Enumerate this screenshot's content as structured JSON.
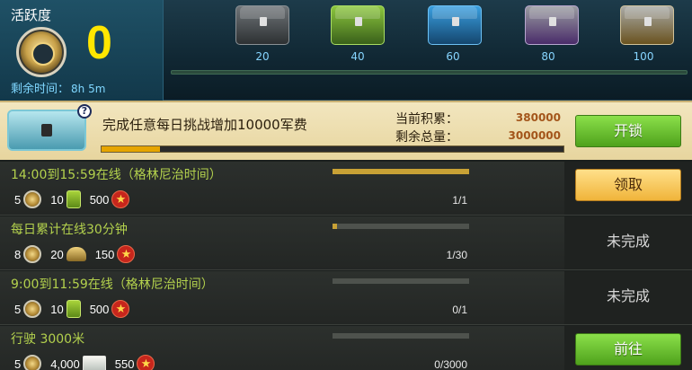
{
  "activity": {
    "title": "活跃度",
    "value": "0",
    "remaining_label": "剩余时间：",
    "remaining_value": "8h 5m",
    "milestones": [
      {
        "label": "20",
        "icon": "gray-crate-icon"
      },
      {
        "label": "40",
        "icon": "green-crate-icon"
      },
      {
        "label": "60",
        "icon": "blue-crate-icon"
      },
      {
        "label": "80",
        "icon": "purple-crate-icon"
      },
      {
        "label": "100",
        "icon": "gold-crate-icon"
      }
    ],
    "progress": 0
  },
  "banner": {
    "help": "?",
    "description": "完成任意每日挑战增加10000军费",
    "current_label": "当前积累：",
    "current_value": "380000",
    "total_label": "剩余总量：",
    "total_value": "3000000",
    "progress_fraction": 0.127,
    "unlock_label": "开锁"
  },
  "tasks": [
    {
      "title": "14:00到15:59在线（格林尼治时间）",
      "rewards": [
        {
          "amount": "5",
          "icon": "medal-icon"
        },
        {
          "amount": "10",
          "icon": "fuel-can-icon"
        },
        {
          "amount": "500",
          "icon": "star-icon"
        }
      ],
      "progress_fraction": 1.0,
      "count": "1/1",
      "action": "领取",
      "action_type": "claim"
    },
    {
      "title": "每日累计在线30分钟",
      "rewards": [
        {
          "amount": "8",
          "icon": "medal-icon"
        },
        {
          "amount": "20",
          "icon": "officer-cap-icon"
        },
        {
          "amount": "150",
          "icon": "star-icon"
        }
      ],
      "progress_fraction": 0.033,
      "count": "1/30",
      "action": "未完成",
      "action_type": "status"
    },
    {
      "title": "9:00到11:59在线（格林尼治时间）",
      "rewards": [
        {
          "amount": "5",
          "icon": "medal-icon"
        },
        {
          "amount": "10",
          "icon": "fuel-can-icon"
        },
        {
          "amount": "500",
          "icon": "star-icon"
        }
      ],
      "progress_fraction": 0,
      "count": "0/1",
      "action": "未完成",
      "action_type": "status"
    },
    {
      "title": "行驶 3000米",
      "rewards": [
        {
          "amount": "5",
          "icon": "medal-icon"
        },
        {
          "amount": "4,000",
          "icon": "cash-icon"
        },
        {
          "amount": "550",
          "icon": "star-icon"
        }
      ],
      "progress_fraction": 0,
      "count": "0/3000",
      "action": "前往",
      "action_type": "go"
    }
  ]
}
